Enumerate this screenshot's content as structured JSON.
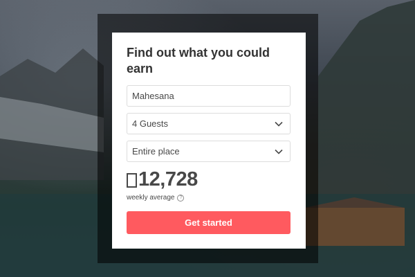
{
  "card": {
    "title": "Find out what you could earn",
    "location_value": "Mahesana",
    "guests_value": "4 Guests",
    "place_type_value": "Entire place",
    "earnings_amount": "12,728",
    "earnings_caption": "weekly average",
    "help_symbol": "?",
    "cta_label": "Get started"
  },
  "colors": {
    "cta_background": "#ff5a5f",
    "text": "#484848",
    "title": "#333333"
  },
  "icons": {
    "dropdown": "chevron-down-icon",
    "help": "question-circle-icon",
    "currency": "currency-glyph-placeholder"
  }
}
